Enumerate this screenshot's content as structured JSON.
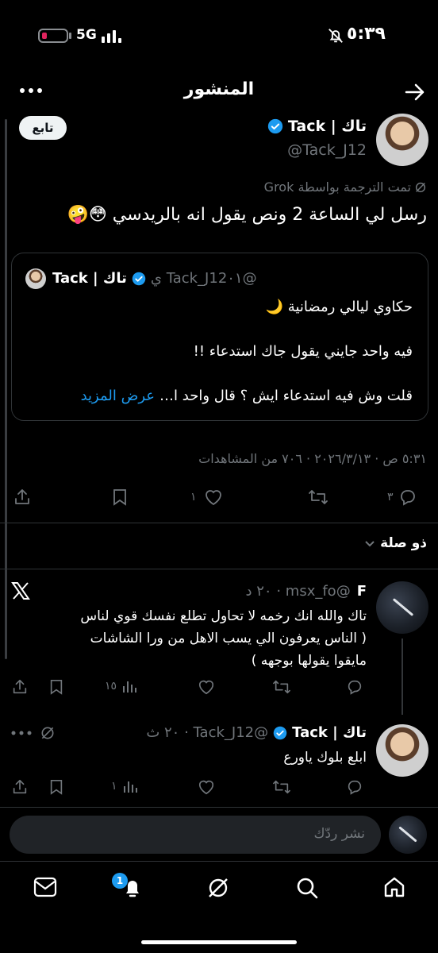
{
  "status_bar": {
    "time": "٥:٣٩",
    "network": "5G"
  },
  "header": {
    "title": "المنشور"
  },
  "post": {
    "author_name": "تاك | Tack",
    "handle": "@Tack_J12",
    "follow_label": "تابع",
    "translated_by": "تمت الترجمة بواسطة Grok",
    "text": "رسل لي الساعة 2 ونص يقول انه بالريدسي 😳🤪",
    "quote": {
      "author_name": "تاك | Tack",
      "handle_time": "@Tack_J12٠١ ي",
      "line1": "حكاوي ليالي رمضانية 🌙",
      "line2": "فيه واحد جايني يقول جاك استدعاء !!",
      "line3": "قلت وش فيه استدعاء ايش ؟ قال واحد ا…",
      "show_more": "عرض المزيد"
    },
    "meta": "٥:٣١ ص · ٢٠٢٦/٣/١٣ · ٧٠٦ من المشاهدات",
    "replies_count": "٣",
    "likes_count": "١",
    "related_label": "ذو صلة"
  },
  "reply1": {
    "name": "F",
    "handle_time": "@msx_fo · ٢٠ د",
    "line1": "تاك والله انك رخمه لا تحاول تطلع نفسك قوي لناس",
    "line2": "( الناس يعرفون الي يسب  الاهل من ورا الشاشات",
    "line3": "مايقوا يقولها بوجهه )",
    "views": "١٥"
  },
  "reply2": {
    "name": "تاك | Tack",
    "handle_time": "@Tack_J12 · ٢٠ ث",
    "text": "ابلع بلوك ياورع",
    "views": "١"
  },
  "reply_input": {
    "placeholder": "نشر ردّك"
  },
  "tab_bar": {
    "notifications_badge": "1"
  },
  "colors": {
    "accent": "#1d9bf0",
    "background": "#000000",
    "muted": "#71767b"
  }
}
